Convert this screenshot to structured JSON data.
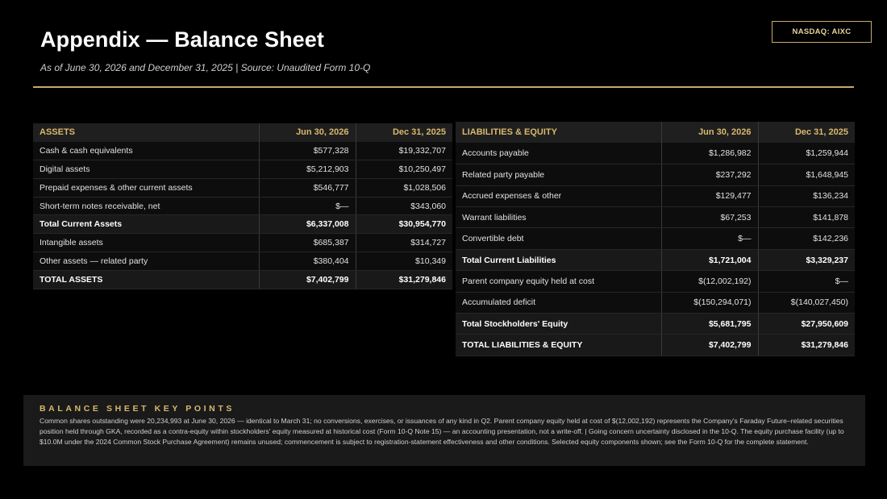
{
  "header": {
    "title": "Appendix — Balance Sheet",
    "subtitle": "As of June 30, 2026 and December 31, 2025  |  Source: Unaudited Form 10-Q",
    "ticker": "NASDAQ: AIXC"
  },
  "assets": {
    "columns": [
      "ASSETS",
      "Jun 30, 2026",
      "Dec 31, 2025"
    ],
    "rows": [
      {
        "label": "Cash & cash equivalents",
        "jun": "$577,328",
        "dec": "$19,332,707",
        "total": false
      },
      {
        "label": "Digital assets",
        "jun": "$5,212,903",
        "dec": "$10,250,497",
        "total": false
      },
      {
        "label": "Prepaid expenses & other current assets",
        "jun": "$546,777",
        "dec": "$1,028,506",
        "total": false
      },
      {
        "label": "Short-term notes receivable, net",
        "jun": "$—",
        "dec": "$343,060",
        "total": false
      },
      {
        "label": "Total Current Assets",
        "jun": "$6,337,008",
        "dec": "$30,954,770",
        "total": true
      },
      {
        "label": "Intangible assets",
        "jun": "$685,387",
        "dec": "$314,727",
        "total": false
      },
      {
        "label": "Other assets — related party",
        "jun": "$380,404",
        "dec": "$10,349",
        "total": false
      },
      {
        "label": "TOTAL ASSETS",
        "jun": "$7,402,799",
        "dec": "$31,279,846",
        "total": true
      }
    ]
  },
  "liabilities": {
    "columns": [
      "LIABILITIES & EQUITY",
      "Jun 30, 2026",
      "Dec 31, 2025"
    ],
    "rows": [
      {
        "label": "Accounts payable",
        "jun": "$1,286,982",
        "dec": "$1,259,944",
        "total": false
      },
      {
        "label": "Related party payable",
        "jun": "$237,292",
        "dec": "$1,648,945",
        "total": false
      },
      {
        "label": "Accrued expenses & other",
        "jun": "$129,477",
        "dec": "$136,234",
        "total": false
      },
      {
        "label": "Warrant liabilities",
        "jun": "$67,253",
        "dec": "$141,878",
        "total": false
      },
      {
        "label": "Convertible debt",
        "jun": "$—",
        "dec": "$142,236",
        "total": false
      },
      {
        "label": "Total Current Liabilities",
        "jun": "$1,721,004",
        "dec": "$3,329,237",
        "total": true
      },
      {
        "label": "Parent company equity held at cost",
        "jun": "$(12,002,192)",
        "dec": "$—",
        "total": false
      },
      {
        "label": "Accumulated deficit",
        "jun": "$(150,294,071)",
        "dec": "$(140,027,450)",
        "total": false
      },
      {
        "label": "Total Stockholders' Equity",
        "jun": "$5,681,795",
        "dec": "$27,950,609",
        "total": true
      },
      {
        "label": "TOTAL LIABILITIES & EQUITY",
        "jun": "$7,402,799",
        "dec": "$31,279,846",
        "total": true
      }
    ]
  },
  "key_points": {
    "heading": "BALANCE SHEET KEY POINTS",
    "body": "Common shares outstanding were 20,234,993 at June 30, 2026 — identical to March 31; no conversions, exercises, or issuances of any kind in Q2. Parent company equity held at cost of $(12,002,192) represents the Company's Faraday Future–related securities position held through GKA, recorded as a contra-equity within stockholders' equity measured at historical cost (Form 10-Q Note 15) — an accounting presentation, not a write-off.  |  Going concern uncertainty disclosed in the 10-Q. The equity purchase facility (up to $10.0M under the 2024 Common Stock Purchase Agreement) remains unused; commencement is subject to registration-statement effectiveness and other conditions. Selected equity components shown; see the Form 10-Q for the complete statement."
  },
  "colors": {
    "accent_gold": "#c8a96a",
    "header_text_gold": "#d9b86e",
    "background": "#000000",
    "total_row": "#191919"
  }
}
